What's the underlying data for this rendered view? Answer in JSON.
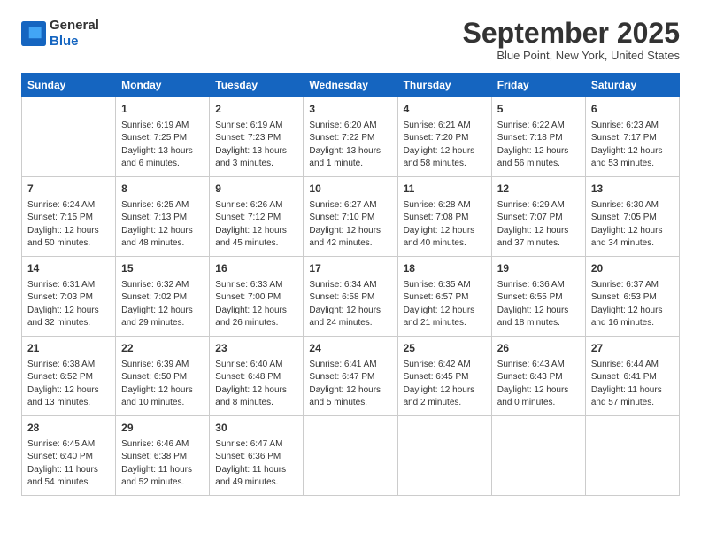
{
  "header": {
    "logo_line1": "General",
    "logo_line2": "Blue",
    "month_title": "September 2025",
    "subtitle": "Blue Point, New York, United States"
  },
  "weekdays": [
    "Sunday",
    "Monday",
    "Tuesday",
    "Wednesday",
    "Thursday",
    "Friday",
    "Saturday"
  ],
  "weeks": [
    [
      {
        "day": "",
        "info": ""
      },
      {
        "day": "1",
        "info": "Sunrise: 6:19 AM\nSunset: 7:25 PM\nDaylight: 13 hours\nand 6 minutes."
      },
      {
        "day": "2",
        "info": "Sunrise: 6:19 AM\nSunset: 7:23 PM\nDaylight: 13 hours\nand 3 minutes."
      },
      {
        "day": "3",
        "info": "Sunrise: 6:20 AM\nSunset: 7:22 PM\nDaylight: 13 hours\nand 1 minute."
      },
      {
        "day": "4",
        "info": "Sunrise: 6:21 AM\nSunset: 7:20 PM\nDaylight: 12 hours\nand 58 minutes."
      },
      {
        "day": "5",
        "info": "Sunrise: 6:22 AM\nSunset: 7:18 PM\nDaylight: 12 hours\nand 56 minutes."
      },
      {
        "day": "6",
        "info": "Sunrise: 6:23 AM\nSunset: 7:17 PM\nDaylight: 12 hours\nand 53 minutes."
      }
    ],
    [
      {
        "day": "7",
        "info": "Sunrise: 6:24 AM\nSunset: 7:15 PM\nDaylight: 12 hours\nand 50 minutes."
      },
      {
        "day": "8",
        "info": "Sunrise: 6:25 AM\nSunset: 7:13 PM\nDaylight: 12 hours\nand 48 minutes."
      },
      {
        "day": "9",
        "info": "Sunrise: 6:26 AM\nSunset: 7:12 PM\nDaylight: 12 hours\nand 45 minutes."
      },
      {
        "day": "10",
        "info": "Sunrise: 6:27 AM\nSunset: 7:10 PM\nDaylight: 12 hours\nand 42 minutes."
      },
      {
        "day": "11",
        "info": "Sunrise: 6:28 AM\nSunset: 7:08 PM\nDaylight: 12 hours\nand 40 minutes."
      },
      {
        "day": "12",
        "info": "Sunrise: 6:29 AM\nSunset: 7:07 PM\nDaylight: 12 hours\nand 37 minutes."
      },
      {
        "day": "13",
        "info": "Sunrise: 6:30 AM\nSunset: 7:05 PM\nDaylight: 12 hours\nand 34 minutes."
      }
    ],
    [
      {
        "day": "14",
        "info": "Sunrise: 6:31 AM\nSunset: 7:03 PM\nDaylight: 12 hours\nand 32 minutes."
      },
      {
        "day": "15",
        "info": "Sunrise: 6:32 AM\nSunset: 7:02 PM\nDaylight: 12 hours\nand 29 minutes."
      },
      {
        "day": "16",
        "info": "Sunrise: 6:33 AM\nSunset: 7:00 PM\nDaylight: 12 hours\nand 26 minutes."
      },
      {
        "day": "17",
        "info": "Sunrise: 6:34 AM\nSunset: 6:58 PM\nDaylight: 12 hours\nand 24 minutes."
      },
      {
        "day": "18",
        "info": "Sunrise: 6:35 AM\nSunset: 6:57 PM\nDaylight: 12 hours\nand 21 minutes."
      },
      {
        "day": "19",
        "info": "Sunrise: 6:36 AM\nSunset: 6:55 PM\nDaylight: 12 hours\nand 18 minutes."
      },
      {
        "day": "20",
        "info": "Sunrise: 6:37 AM\nSunset: 6:53 PM\nDaylight: 12 hours\nand 16 minutes."
      }
    ],
    [
      {
        "day": "21",
        "info": "Sunrise: 6:38 AM\nSunset: 6:52 PM\nDaylight: 12 hours\nand 13 minutes."
      },
      {
        "day": "22",
        "info": "Sunrise: 6:39 AM\nSunset: 6:50 PM\nDaylight: 12 hours\nand 10 minutes."
      },
      {
        "day": "23",
        "info": "Sunrise: 6:40 AM\nSunset: 6:48 PM\nDaylight: 12 hours\nand 8 minutes."
      },
      {
        "day": "24",
        "info": "Sunrise: 6:41 AM\nSunset: 6:47 PM\nDaylight: 12 hours\nand 5 minutes."
      },
      {
        "day": "25",
        "info": "Sunrise: 6:42 AM\nSunset: 6:45 PM\nDaylight: 12 hours\nand 2 minutes."
      },
      {
        "day": "26",
        "info": "Sunrise: 6:43 AM\nSunset: 6:43 PM\nDaylight: 12 hours\nand 0 minutes."
      },
      {
        "day": "27",
        "info": "Sunrise: 6:44 AM\nSunset: 6:41 PM\nDaylight: 11 hours\nand 57 minutes."
      }
    ],
    [
      {
        "day": "28",
        "info": "Sunrise: 6:45 AM\nSunset: 6:40 PM\nDaylight: 11 hours\nand 54 minutes."
      },
      {
        "day": "29",
        "info": "Sunrise: 6:46 AM\nSunset: 6:38 PM\nDaylight: 11 hours\nand 52 minutes."
      },
      {
        "day": "30",
        "info": "Sunrise: 6:47 AM\nSunset: 6:36 PM\nDaylight: 11 hours\nand 49 minutes."
      },
      {
        "day": "",
        "info": ""
      },
      {
        "day": "",
        "info": ""
      },
      {
        "day": "",
        "info": ""
      },
      {
        "day": "",
        "info": ""
      }
    ]
  ]
}
